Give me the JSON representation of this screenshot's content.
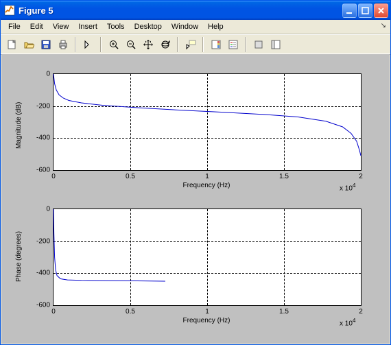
{
  "window": {
    "title": "Figure 5"
  },
  "menus": {
    "file": "File",
    "edit": "Edit",
    "view": "View",
    "insert": "Insert",
    "tools": "Tools",
    "desktop": "Desktop",
    "window": "Window",
    "help": "Help"
  },
  "toolbar_icons": {
    "new": "new-file-icon",
    "open": "open-icon",
    "save": "save-icon",
    "print": "print-icon",
    "pointer": "pointer-icon",
    "zoomin": "zoom-in-icon",
    "zoomout": "zoom-out-icon",
    "pan": "pan-icon",
    "rotate": "rotate3d-icon",
    "cursor": "data-cursor-icon",
    "colorbar": "colorbar-icon",
    "legend": "legend-icon",
    "hide": "hide-tools-icon",
    "show": "show-tools-icon"
  },
  "chart_data": [
    {
      "type": "line",
      "title": "",
      "xlabel": "Frequency (Hz)",
      "ylabel": "Magnitude (dB)",
      "xlim": [
        0,
        22000
      ],
      "ylim": [
        -600,
        0
      ],
      "xticks": [
        0,
        5000,
        10000,
        15000,
        20000
      ],
      "xticklabels": [
        "0",
        "0.5",
        "1",
        "1.5",
        "2"
      ],
      "x_exponent": "x 10^4",
      "yticks": [
        -600,
        -400,
        -200,
        0
      ],
      "yticklabels": [
        "-600",
        "-400",
        "-200",
        "0"
      ],
      "series": [
        {
          "name": "magnitude",
          "color": "#0000cc",
          "x": [
            0,
            80,
            200,
            400,
            700,
            1100,
            2000,
            3500,
            6000,
            9000,
            12000,
            15000,
            17500,
            19500,
            20700,
            21300,
            21700,
            21900,
            22000
          ],
          "y": [
            0,
            -60,
            -100,
            -130,
            -150,
            -165,
            -180,
            -195,
            -210,
            -225,
            -238,
            -252,
            -268,
            -295,
            -330,
            -370,
            -420,
            -475,
            -510
          ]
        }
      ]
    },
    {
      "type": "line",
      "title": "",
      "xlabel": "Frequency (Hz)",
      "ylabel": "Phase (degrees)",
      "xlim": [
        0,
        22000
      ],
      "ylim": [
        -600,
        0
      ],
      "xticks": [
        0,
        5000,
        10000,
        15000,
        20000
      ],
      "xticklabels": [
        "0",
        "0.5",
        "1",
        "1.5",
        "2"
      ],
      "x_exponent": "x 10^4",
      "yticks": [
        -600,
        -400,
        -200,
        0
      ],
      "yticklabels": [
        "-600",
        "-400",
        "-200",
        "0"
      ],
      "series": [
        {
          "name": "phase",
          "color": "#0000cc",
          "x": [
            0,
            30,
            80,
            150,
            250,
            500,
            1000,
            2000,
            4000,
            6000,
            8000
          ],
          "y": [
            0,
            -150,
            -300,
            -380,
            -415,
            -435,
            -442,
            -445,
            -447,
            -448,
            -450
          ]
        }
      ]
    }
  ]
}
